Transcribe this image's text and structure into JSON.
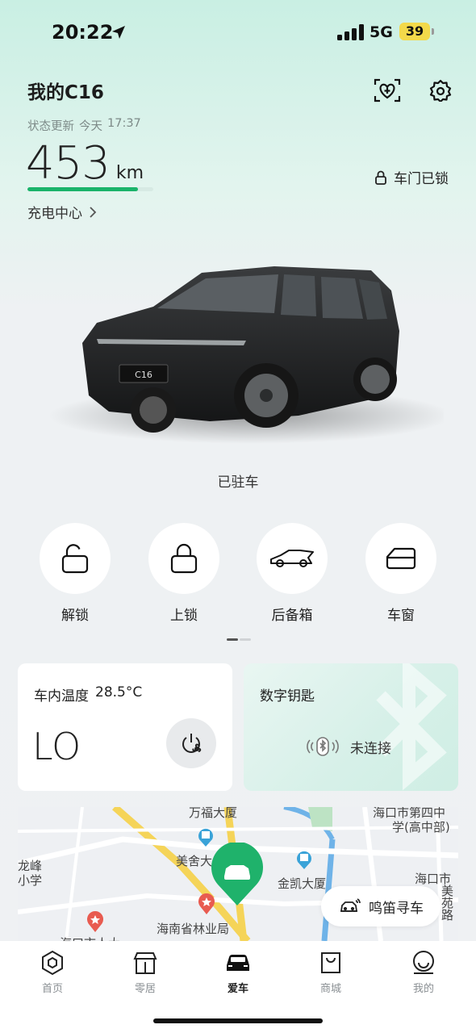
{
  "status_bar": {
    "time": "20:22",
    "network": "5G",
    "battery": "39"
  },
  "header": {
    "car_name": "我的C16",
    "update_label": "状态更新",
    "update_day": "今天",
    "update_time": "17:37",
    "range_value": "453",
    "range_unit": "km",
    "range_level_fraction": 0.88,
    "charge_link": "充电中心",
    "door_status": "车门已锁"
  },
  "car": {
    "status": "已驻车"
  },
  "controls": [
    {
      "label": "解锁",
      "icon": "unlock-icon"
    },
    {
      "label": "上锁",
      "icon": "lock-icon"
    },
    {
      "label": "后备箱",
      "icon": "trunk-icon"
    },
    {
      "label": "车窗",
      "icon": "window-icon"
    }
  ],
  "cards": {
    "temperature": {
      "title": "车内温度",
      "value": "28.5°C",
      "setting": "LO"
    },
    "digital_key": {
      "title": "数字钥匙",
      "status": "未连接"
    }
  },
  "map": {
    "labels": [
      "万福大厦",
      "海口市第四中",
      "学(高中部)",
      "龙峰",
      "小学",
      "美舍大",
      "金凯大厦",
      "海口市",
      "海南省林业局",
      "海口市人大",
      "美苑路"
    ],
    "horn_button": "鸣笛寻车"
  },
  "tabbar": [
    {
      "label": "首页",
      "icon": "home-hexagon-icon"
    },
    {
      "label": "零居",
      "icon": "house-icon"
    },
    {
      "label": "爱车",
      "icon": "car-icon"
    },
    {
      "label": "商城",
      "icon": "shopping-bag-icon"
    },
    {
      "label": "我的",
      "icon": "profile-icon"
    }
  ],
  "colors": {
    "accent_green": "#1ab36a",
    "battery_yellow": "#f3d94a"
  }
}
